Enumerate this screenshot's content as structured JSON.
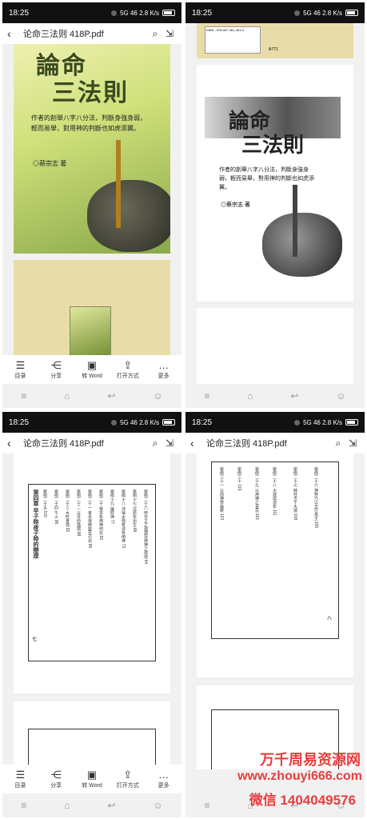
{
  "status": {
    "time": "18:25",
    "network": "5G 46 2.8 K/s"
  },
  "file": {
    "title": "论命三法则 418P.pdf"
  },
  "toolbar": [
    {
      "label": "目录",
      "icon": "list-icon"
    },
    {
      "label": "分享",
      "icon": "share-icon"
    },
    {
      "label": "转 Word",
      "icon": "word-icon"
    },
    {
      "label": "打开方式",
      "icon": "open-with-icon"
    },
    {
      "label": "更多",
      "icon": "more-icon"
    }
  ],
  "cover": {
    "title_line1": "論命",
    "title_line2": "三法則",
    "subtitle": "作者的創舉八字八分法，判斷身強身弱，輕而易舉，對用神的判斷也如虎添翼。",
    "author": "◎蔡宗志 著"
  },
  "barcode": {
    "isbn": "ISBN : 978-957-351-451-0",
    "code": "A771"
  },
  "toc_left": {
    "chapter": "第四章 早子時夜子時的辯證",
    "page_num": "七",
    "items": [
      "案例二十六 辨日主之強弱及用神之辯證 64",
      "案例十七 戊辰年出生 68",
      "案例十八 沖得太強有沒有用神 73",
      "案例十九 論財神 77",
      "案例二十 我本有用神何在 81",
      "案例二十一 金水運時能否引出 85",
      "案例二十二 以月份強弱 88",
      "案例二十三 水旺身弱 92",
      "案例二十四 午火 96",
      "案例二十五 100"
    ]
  },
  "toc_right": {
    "page_num": "八",
    "items": [
      "案例二十六 神煞乃以五行為主 105",
      "案例二十七 時柱五十大運 108",
      "案例二十八 大運與流年 111",
      "案例二十九 以用神之喜忌 115",
      "案例三十 119",
      "案例三十一 以前神學論統 123"
    ]
  },
  "watermark": {
    "line1": "万千周易资源网",
    "line2": "www.zhouyi666.com",
    "line3": "微信 1404049576"
  }
}
